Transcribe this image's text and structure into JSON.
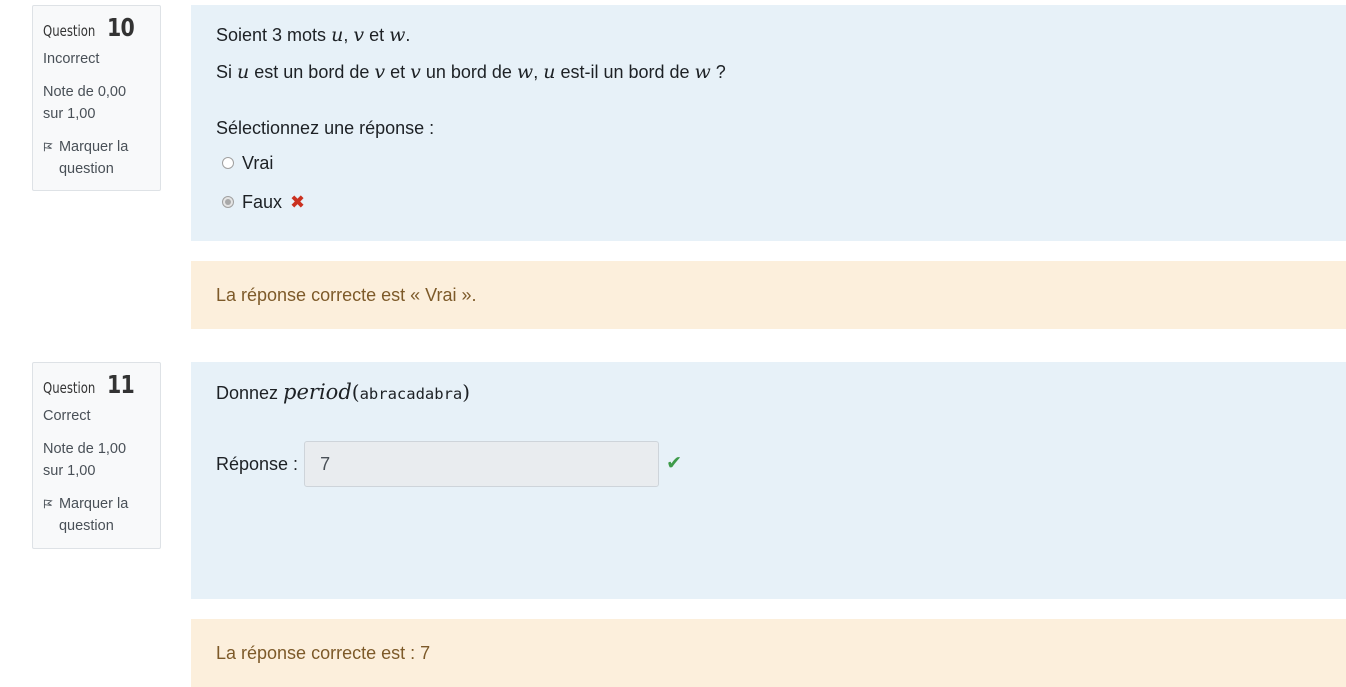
{
  "questions": [
    {
      "label": "Question",
      "number": "10",
      "state": "Incorrect",
      "grade": "Note de 0,00 sur 1,00",
      "flag_label": "Marquer la question",
      "q_part1": "Soient 3 mots ",
      "q_u": "u",
      "q_sep": ", ",
      "q_v": "v",
      "q_et": " et ",
      "q_w": "w",
      "q_dot": ".",
      "l2_si": "Si ",
      "l2_u": "u",
      "l2_a": " est un bord de ",
      "l2_v1": "v",
      "l2_b": " et ",
      "l2_v2": "v",
      "l2_c": " un bord de ",
      "l2_w1": "w",
      "l2_d": ",  ",
      "l2_u2": "u",
      "l2_e": " est-il un bord de ",
      "l2_w2": "w",
      "l2_f": " ?",
      "prompt": "Sélectionnez une réponse :",
      "options": [
        {
          "label": "Vrai",
          "selected": false
        },
        {
          "label": "Faux",
          "selected": true
        }
      ],
      "result_icon": "cross-icon",
      "feedback": "La réponse correcte est « Vrai »."
    },
    {
      "label": "Question",
      "number": "11",
      "state": "Correct",
      "grade": "Note de 1,00 sur 1,00",
      "flag_label": "Marquer la question",
      "q_text": "Donnez ",
      "q_fn": "period",
      "q_open": "(",
      "q_arg": "abracadabra",
      "q_close": ")",
      "answer_label": "Réponse :",
      "answer_value": "7",
      "result_icon": "check-icon",
      "feedback": "La réponse correcte est : 7"
    }
  ],
  "colors": {
    "content_bg": "#e7f1f8",
    "feedback_bg": "#fcefdc",
    "feedback_text": "#7d5a29",
    "incorrect": "#ca3120",
    "correct": "#3e9b4a"
  }
}
